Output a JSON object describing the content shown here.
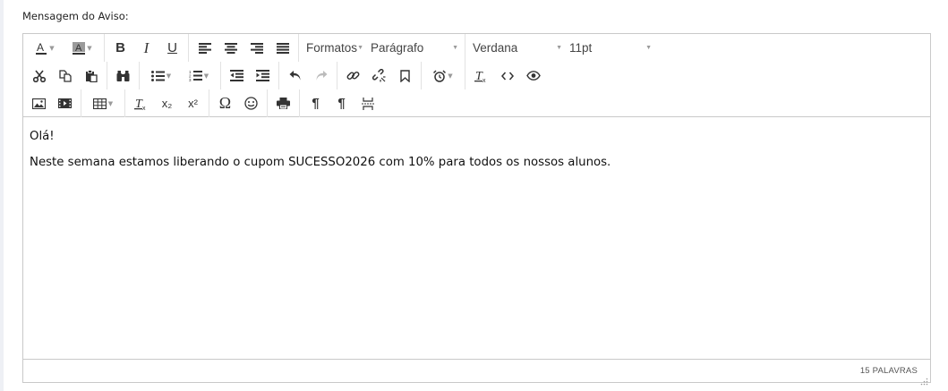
{
  "field_label": "Mensagem do Aviso:",
  "toolbar": {
    "formats_label": "Formatos",
    "block_label": "Parágrafo",
    "font_family": "Verdana",
    "font_size": "11pt",
    "bold_glyph": "B",
    "italic_glyph": "I",
    "underline_glyph": "U",
    "omega_glyph": "Ω",
    "subscript_glyph": "x₂",
    "superscript_glyph": "x²",
    "pilcrow_glyph": "¶",
    "icons": [
      "font-color-icon",
      "background-color-icon",
      "bold-icon",
      "italic-icon",
      "underline-icon",
      "align-left-icon",
      "align-center-icon",
      "align-right-icon",
      "align-justify-icon",
      "cut-icon",
      "copy-icon",
      "paste-icon",
      "find-icon",
      "bullet-list-icon",
      "numbered-list-icon",
      "outdent-icon",
      "indent-icon",
      "undo-icon",
      "redo-icon",
      "link-icon",
      "unlink-icon",
      "anchor-icon",
      "alarm-icon",
      "clear-format-icon",
      "code-icon",
      "preview-icon",
      "image-icon",
      "media-icon",
      "table-icon",
      "remove-format-icon",
      "subscript-icon",
      "superscript-icon",
      "special-char-icon",
      "emoticon-icon",
      "print-icon",
      "ltr-icon",
      "rtl-icon",
      "page-break-icon"
    ]
  },
  "content": {
    "greeting": "Olá!",
    "body": "Neste semana estamos liberando o cupom SUCESSO2026 com 10% para todos os nossos alunos."
  },
  "statusbar": {
    "word_count": "15 PALAVRAS"
  },
  "colors": {
    "border": "#c9c9c9",
    "icon": "#333333",
    "caret": "#9a9a9a",
    "page_strip": "#eef0f5"
  }
}
